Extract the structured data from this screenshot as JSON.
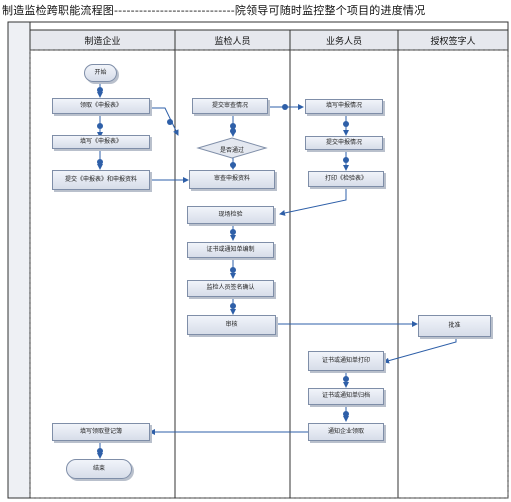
{
  "title": "制造监检跨职能流程图-----------------------------院领导可随时监控整个项目的进度情况",
  "lanes": [
    "制造企业",
    "监检人员",
    "业务人员",
    "授权签字人"
  ],
  "nodes": {
    "start": "开始",
    "n1": "领取《申报表》",
    "n2": "填写《申报表》",
    "n3": "提交《申报表》和申报资料",
    "m1": "提交审查情况",
    "m2": "是否通过",
    "m3": "审查申报资料",
    "m4": "现场检验",
    "m5": "证书或通知单编制",
    "m6": "监检人员签名确认",
    "m7": "审核",
    "b1": "填写申报情况",
    "b2": "提交申报情况",
    "b3": "打印《检验表》",
    "b4": "证书或通知单打印",
    "b5": "证书或通知单归档",
    "b6": "通知企业领取",
    "a1": "批准",
    "n4": "填写领取登记簿",
    "end": "结束"
  }
}
